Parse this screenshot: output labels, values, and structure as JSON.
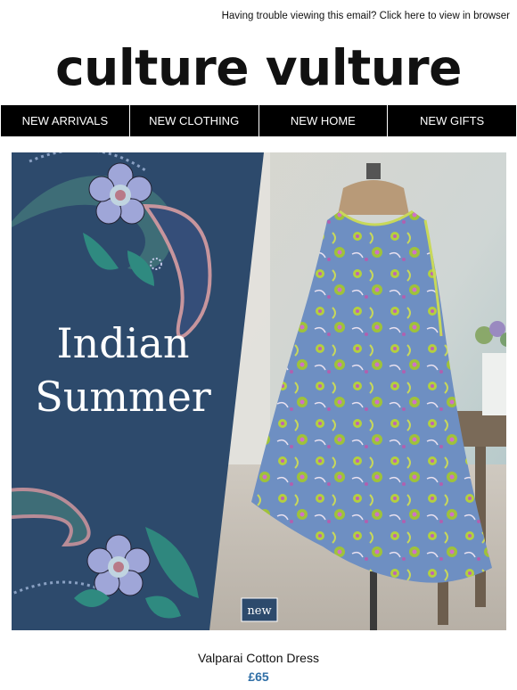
{
  "header": {
    "view_browser_text": "Having trouble viewing this email? Click here to view in browser"
  },
  "brand": {
    "logo_text": "culture vulture"
  },
  "nav": [
    {
      "label": "NEW ARRIVALS"
    },
    {
      "label": "NEW CLOTHING"
    },
    {
      "label": "NEW HOME"
    },
    {
      "label": "NEW GIFTS"
    }
  ],
  "hero": {
    "title_line1": "Indian",
    "title_line2": "Summer",
    "badge": "new"
  },
  "product": {
    "name": "Valparai Cotton Dress",
    "price": "£65"
  },
  "colors": {
    "panel_navy": "#2d4a6c",
    "price_blue": "#2e6ea6",
    "dress_blue": "#6e8fc2"
  }
}
